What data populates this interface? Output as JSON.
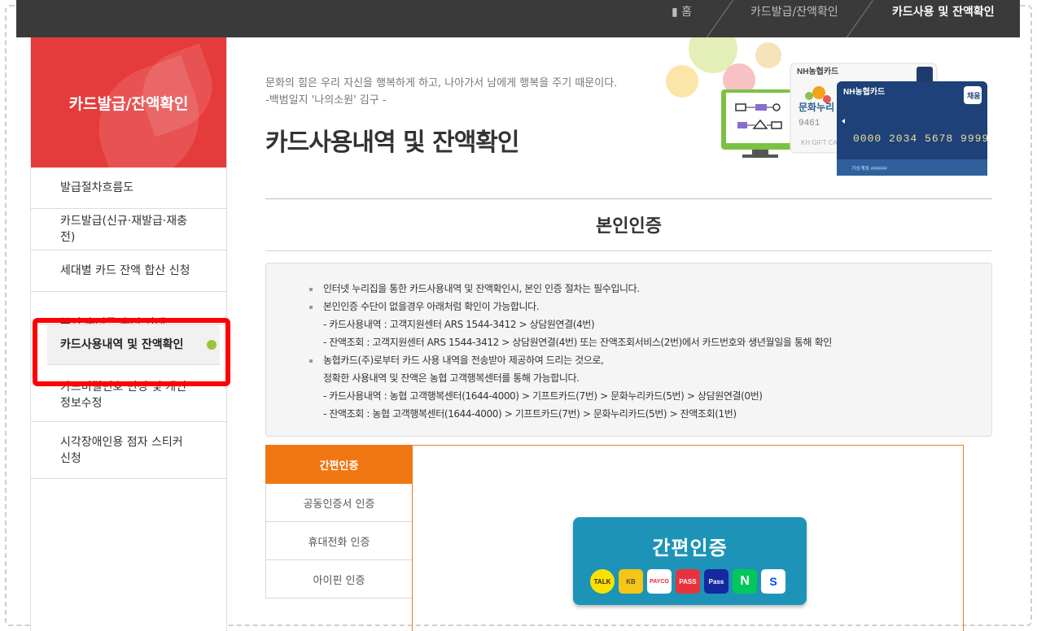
{
  "breadcrumb": {
    "home": "홈",
    "middle": "카드발급/잔액확인",
    "current": "카드사용 및 잔액확인"
  },
  "sidebar": {
    "title": "카드발급/잔액확인",
    "items": [
      {
        "label": "발급절차흐름도"
      },
      {
        "label": "카드발급(신규·재발급·재충전)"
      },
      {
        "label": "세대별 카드 잔액 합산 신청"
      },
      {
        "label": "본인 충전금 충전 안내"
      },
      {
        "label": "카드사용내역 및 잔액확인"
      },
      {
        "label": "카드비밀번호 변경 및 개인정보수정"
      },
      {
        "label": "시각장애인용 점자 스티커 신청"
      }
    ]
  },
  "header": {
    "quote_line1": "문화의 힘은 우리 자신을 행복하게 하고, 나아가서 남에게 행복을 주기 때문이다.",
    "quote_line2": "-백범일지 '나의소원' 김구 -",
    "page_title": "카드사용내역 및 잔액확인"
  },
  "banner": {
    "card_brand": "NH농협카드",
    "card_number": "0000 2034 5678 9999",
    "card_tag": "채움",
    "gift_label": "문화누리",
    "gift_number": "9461"
  },
  "section_title": "본인인증",
  "notice": {
    "lines": [
      {
        "text": "인터넷 누리집을 통한 카드사용내역 및 잔액확인시, 본인 인증 절차는 필수입니다.",
        "bullet": true
      },
      {
        "text": "본인인증 수단이 없을경우 아래처럼 확인이 가능합니다.",
        "bullet": true
      },
      {
        "text": "- 카드사용내역 : 고객지원센터 ARS 1544-3412 > 상담원연결(4번)",
        "bullet": false
      },
      {
        "text": "- 잔액조회 : 고객지원센터 ARS 1544-3412 > 상담원연결(4번) 또는 잔액조회서비스(2번)에서 카드번호와 생년월일을 통해 확인",
        "bullet": false
      },
      {
        "text": "농협카드(주)로부터 카드 사용 내역을 전송받아 제공하여 드리는 것으로,",
        "bullet": true
      },
      {
        "text": "정확한 사용내역 및 잔액은 농협 고객행복센터를 통해 가능합니다.",
        "bullet": false
      },
      {
        "text": "- 카드사용내역 : 농협 고객행복센터(1644-4000) > 기프트카드(7번) > 문화누리카드(5번) > 상담원연결(0번)",
        "bullet": false
      },
      {
        "text": "- 잔액조회 : 농협 고객행복센터(1644-4000) > 기프트카드(7번) > 문화누리카드(5번) > 잔액조회(1번)",
        "bullet": false
      }
    ]
  },
  "auth": {
    "tabs": [
      {
        "label": "간편인증",
        "active": true
      },
      {
        "label": "공동인증서 인증",
        "active": false
      },
      {
        "label": "휴대전화 인증",
        "active": false
      },
      {
        "label": "아이핀 인증",
        "active": false
      }
    ],
    "simple_title": "간편인증",
    "providers": [
      {
        "name": "kakao-talk",
        "label": "TALK",
        "bg": "#fae100",
        "fg": "#3a1d1d"
      },
      {
        "name": "kb",
        "label": "KB",
        "bg": "#f5c518",
        "fg": "#5a4a2a"
      },
      {
        "name": "payco",
        "label": "PAYCO",
        "bg": "#ffffff",
        "fg": "#e8222b"
      },
      {
        "name": "pass-skt",
        "label": "PASS",
        "bg": "#e8333c",
        "fg": "#ffffff"
      },
      {
        "name": "pass-samsung",
        "label": "Pass",
        "bg": "#1428a0",
        "fg": "#ffffff"
      },
      {
        "name": "naver",
        "label": "N",
        "bg": "#03c75a",
        "fg": "#ffffff"
      },
      {
        "name": "shinhan",
        "label": "S",
        "bg": "#ffffff",
        "fg": "#0046ff"
      }
    ]
  }
}
